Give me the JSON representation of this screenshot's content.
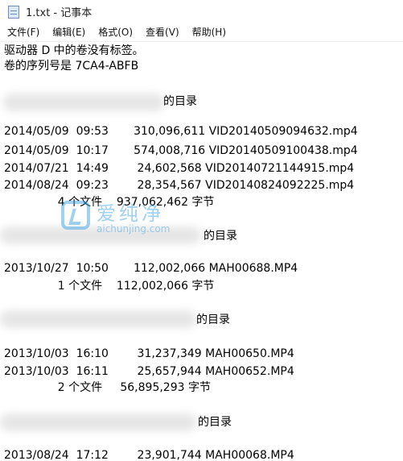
{
  "window": {
    "title": "1.txt - 记事本"
  },
  "menu": {
    "file": "文件(F)",
    "edit": "编辑(E)",
    "format": "格式(O)",
    "view": "查看(V)",
    "help": "帮助(H)"
  },
  "document": {
    "line1": "驱动器 D 中的卷没有标签。",
    "line2": "卷的序列号是 7CA4-ABFB",
    "dir1_header": "的目录",
    "dir1_file1": "2014/05/09  09:53       310,096,611 VID20140509094632.mp4",
    "dir1_file2": "2014/05/09  10:17       574,008,716 VID20140509100438.mp4",
    "dir1_file3": "2014/07/21  14:49        24,602,568 VID20140721144915.mp4",
    "dir1_file4": "2014/08/24  09:23        28,354,567 VID20140824092225.mp4",
    "dir1_summary": "               4 个文件    937,062,462 字节",
    "dir2_header": "的目录",
    "dir2_file1": "2013/10/27  10:50       112,002,066 MAH00688.MP4",
    "dir2_summary": "               1 个文件    112,002,066 字节",
    "dir3_header": "的目录",
    "dir3_file1": "2013/10/03  16:10        31,237,349 MAH00650.MP4",
    "dir3_file2": "2013/10/03  16:11        25,657,944 MAH00652.MP4",
    "dir3_summary": "               2 个文件     56,895,293 字节",
    "dir4_header": "的目录",
    "dir4_file1": "2013/08/24  17:12        23,901,744 MAH00068.MP4"
  },
  "watermark": {
    "name": "爱纯净",
    "url": "aichunjing.com",
    "color": "#2e9be0"
  }
}
